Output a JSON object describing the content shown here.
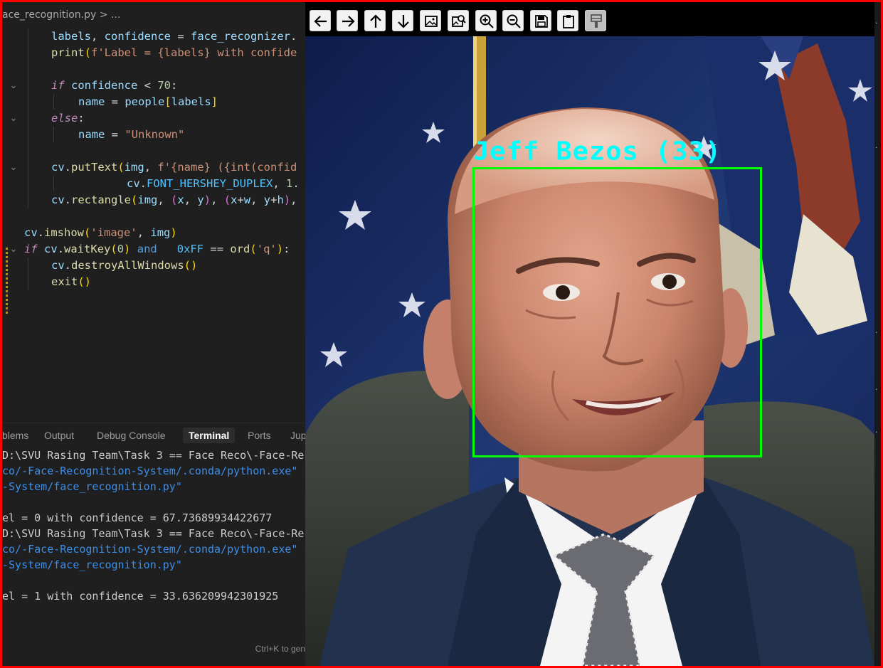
{
  "editor": {
    "breadcrumb": {
      "file": "ace_recognition.py",
      "separator": ">",
      "trail": "..."
    },
    "code_lines": [
      "labels, confidence = face_recognizer.",
      "print(f'Label = {labels} with confide",
      "",
      "if confidence < 70:",
      "name = people[labels]",
      "else:",
      "name = \"Unknown\"",
      "",
      "cv.putText(img, f'{name} ({int(confid",
      "cv.FONT_HERSHEY_DUPLEX, 1.",
      "cv.rectangle(img, (x, y), (x+w, y+h),",
      "",
      "cv.imshow('image', img)",
      "if cv.waitKey(0) and   0xFF == ord('q'):",
      "cv.destroyAllWindows()",
      "exit()"
    ]
  },
  "panel": {
    "tabs": [
      {
        "label": "blems"
      },
      {
        "label": "Output"
      },
      {
        "label": "Debug Console"
      },
      {
        "label": "Terminal",
        "active": true
      },
      {
        "label": "Ports"
      },
      {
        "label": "Jup"
      }
    ],
    "terminal_lines": [
      {
        "text": "D:\\SVU Rasing Team\\Task 3 == Face Reco\\-Face-Reco",
        "color": "white"
      },
      {
        "text": "co/-Face-Recognition-System/.conda/python.exe\" \"",
        "color": "blue"
      },
      {
        "text": "-System/face_recognition.py\"",
        "color": "blue"
      },
      {
        "text": "",
        "color": "white"
      },
      {
        "text": "el = 0 with confidence = 67.73689934422677",
        "color": "white"
      },
      {
        "text": "D:\\SVU Rasing Team\\Task 3 == Face Reco\\-Face-Reco",
        "color": "white"
      },
      {
        "text": "co/-Face-Recognition-System/.conda/python.exe\" \"",
        "color": "blue"
      },
      {
        "text": "-System/face_recognition.py\"",
        "color": "blue"
      },
      {
        "text": "",
        "color": "white"
      },
      {
        "text": "el = 1 with confidence = 33.636209942301925",
        "color": "white"
      }
    ],
    "hint": "Ctrl+K to gen"
  },
  "viewer": {
    "toolbar": [
      {
        "icon": "arrow-left-icon"
      },
      {
        "icon": "arrow-right-icon"
      },
      {
        "icon": "arrow-up-icon"
      },
      {
        "icon": "arrow-down-icon"
      },
      {
        "icon": "image-icon"
      },
      {
        "icon": "image-search-icon"
      },
      {
        "icon": "zoom-in-icon"
      },
      {
        "icon": "zoom-out-icon"
      },
      {
        "icon": "save-icon"
      },
      {
        "icon": "clipboard-icon"
      },
      {
        "icon": "paint-brush-icon"
      }
    ],
    "face_label": "Jeff Bezos (33)",
    "label_color": "#00ffff",
    "box_color": "#00ff00"
  },
  "colors": {
    "frame": "#ff0000",
    "editor_bg": "#1f1f1f"
  }
}
